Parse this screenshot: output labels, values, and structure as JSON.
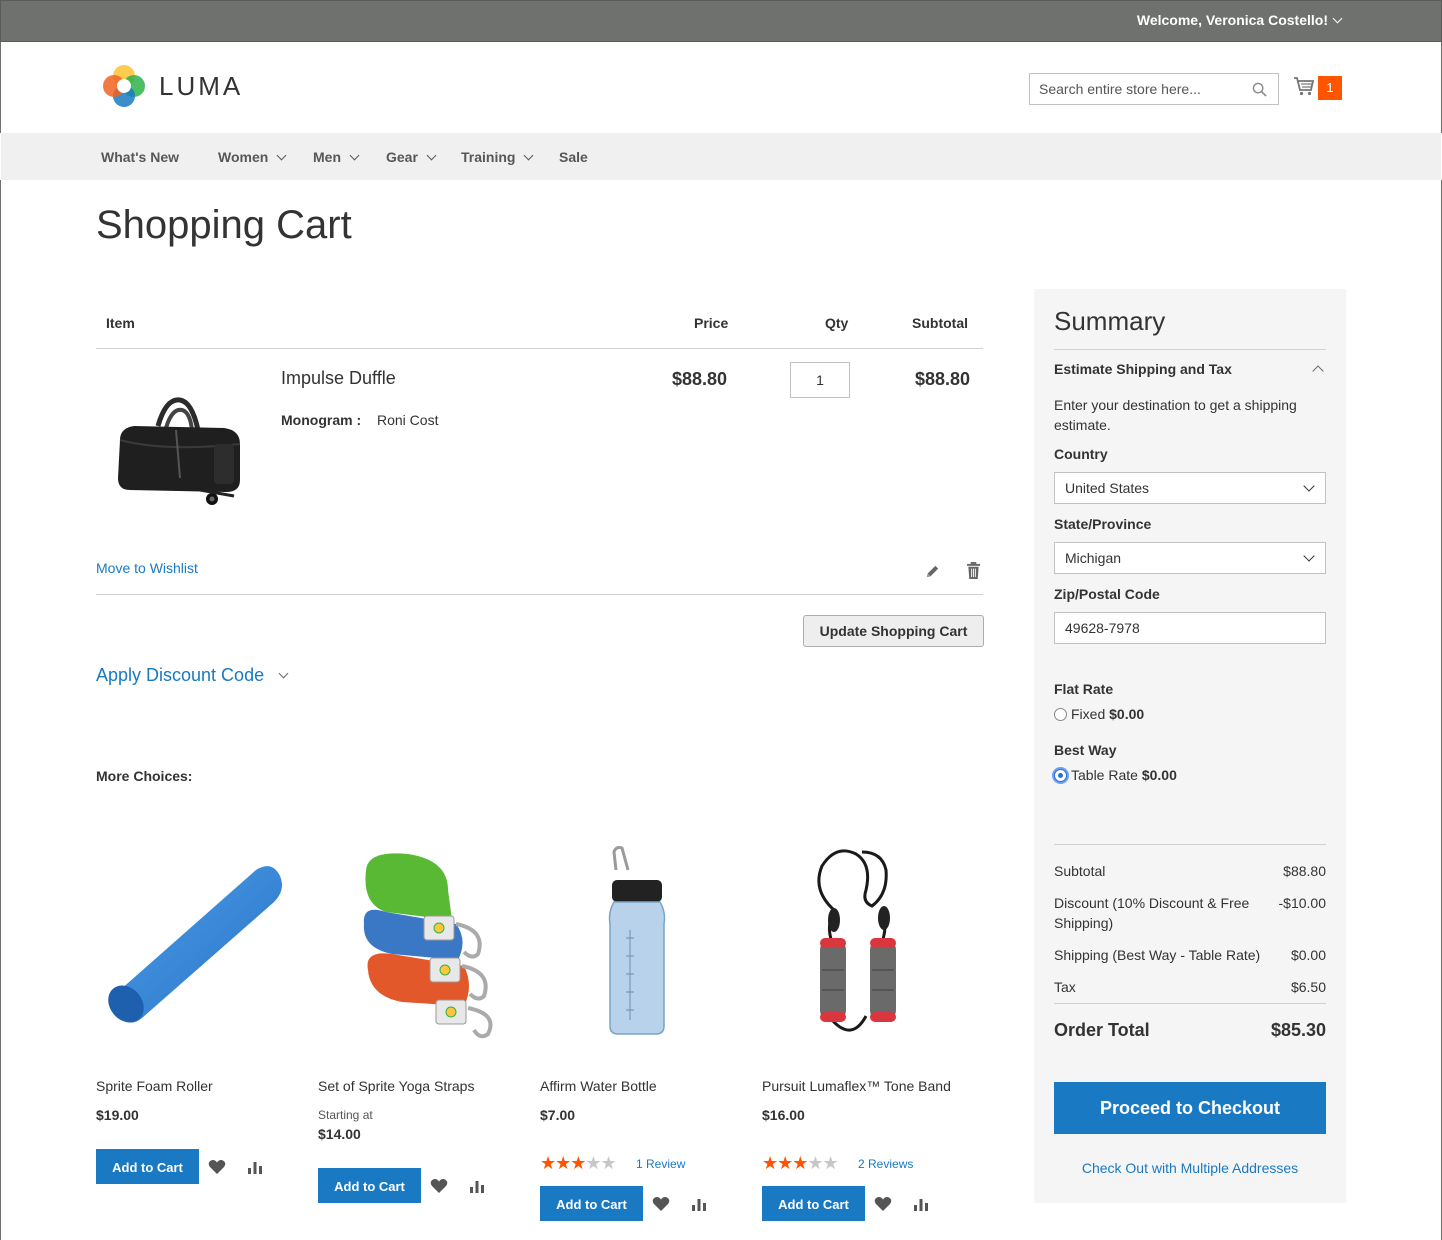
{
  "top_bar": {
    "welcome": "Welcome, Veronica Costello!"
  },
  "header": {
    "logo_text": "LUMA",
    "search_placeholder": "Search entire store here...",
    "cart_count": "1",
    "colors": {
      "accent": "#1979c3",
      "badge": "#ff5501",
      "topbar": "#6e716e"
    }
  },
  "nav": [
    {
      "label": "What's New",
      "has_menu": false
    },
    {
      "label": "Women",
      "has_menu": true
    },
    {
      "label": "Men",
      "has_menu": true
    },
    {
      "label": "Gear",
      "has_menu": true
    },
    {
      "label": "Training",
      "has_menu": true
    },
    {
      "label": "Sale",
      "has_menu": false
    }
  ],
  "page_title": "Shopping Cart",
  "cart": {
    "headers": {
      "item": "Item",
      "price": "Price",
      "qty": "Qty",
      "subtotal": "Subtotal"
    },
    "items": [
      {
        "name": "Impulse Duffle",
        "option_label": "Monogram :",
        "option_value": "Roni Cost",
        "price": "$88.80",
        "qty": "1",
        "subtotal": "$88.80",
        "image": "black-duffle-bag"
      }
    ],
    "move_to_wishlist": "Move to Wishlist",
    "update_button": "Update Shopping Cart",
    "discount_toggle": "Apply Discount Code"
  },
  "more_choices": {
    "title": "More Choices:",
    "products": [
      {
        "name": "Sprite Foam Roller",
        "price": "$19.00",
        "starting_at": "",
        "rating_stars": 0,
        "reviews": "",
        "add_label": "Add to Cart",
        "image": "blue-foam-roller"
      },
      {
        "name": "Set of Sprite Yoga Straps",
        "price": "$14.00",
        "starting_at": "Starting at",
        "rating_stars": 0,
        "reviews": "",
        "add_label": "Add to Cart",
        "image": "yoga-straps"
      },
      {
        "name": "Affirm Water Bottle",
        "price": "$7.00",
        "starting_at": "",
        "rating_stars": 3,
        "reviews": "1 Review",
        "add_label": "Add to Cart",
        "image": "water-bottle"
      },
      {
        "name": "Pursuit Lumaflex™ Tone Band",
        "price": "$16.00",
        "starting_at": "",
        "rating_stars": 3,
        "reviews": "2 Reviews",
        "add_label": "Add to Cart",
        "image": "tone-band"
      }
    ]
  },
  "summary": {
    "title": "Summary",
    "estimate_title": "Estimate Shipping and Tax",
    "estimate_desc": "Enter your destination to get a shipping estimate.",
    "country_label": "Country",
    "country_value": "United States",
    "state_label": "State/Province",
    "state_value": "Michigan",
    "zip_label": "Zip/Postal Code",
    "zip_value": "49628-7978",
    "shipping_methods": [
      {
        "carrier": "Flat Rate",
        "method": "Fixed",
        "amount": "$0.00",
        "selected": false
      },
      {
        "carrier": "Best Way",
        "method": "Table Rate",
        "amount": "$0.00",
        "selected": true
      }
    ],
    "totals": [
      {
        "label": "Subtotal",
        "value": "$88.80"
      },
      {
        "label": "Discount (10% Discount & Free Shipping)",
        "value": "-$10.00"
      },
      {
        "label": "Shipping (Best Way - Table Rate)",
        "value": "$0.00"
      },
      {
        "label": "Tax",
        "value": "$6.50"
      }
    ],
    "order_total_label": "Order Total",
    "order_total_value": "$85.30",
    "checkout_button": "Proceed to Checkout",
    "multi_address_link": "Check Out with Multiple Addresses"
  }
}
